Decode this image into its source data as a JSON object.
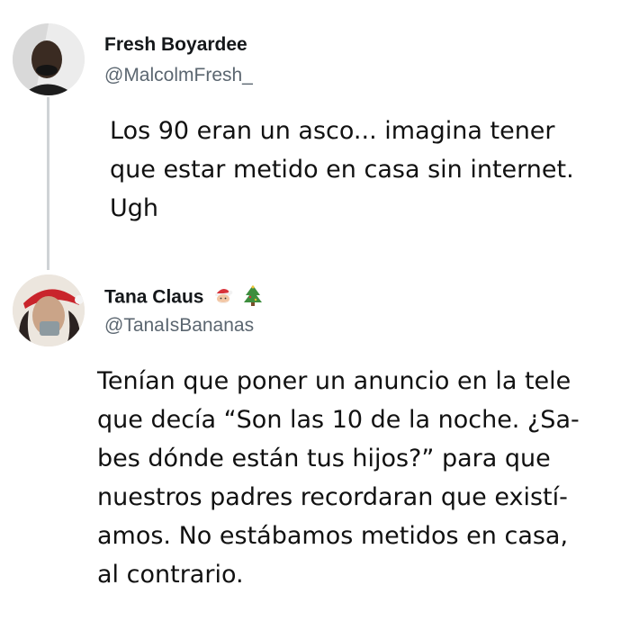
{
  "tweets": [
    {
      "name": "Fresh Boyardee",
      "handle": "@MalcolmFresh_",
      "text": "Los 90 eran un asco... imagina tener\nque estar metido en casa sin internet.\nUgh"
    },
    {
      "name": "Tana Claus",
      "name_emoji": [
        "santa-face-icon",
        "christmas-tree-icon"
      ],
      "handle": "@TanaIsBananas",
      "text": "Tenían que poner un anuncio en la tele\nque decía “Son las 10 de la noche. ¿Sa-\nbes dónde están tus hijos?” para que\nnuestros padres recordaran que existí-\namos. No estábamos metidos en casa,\nal contrario."
    }
  ]
}
